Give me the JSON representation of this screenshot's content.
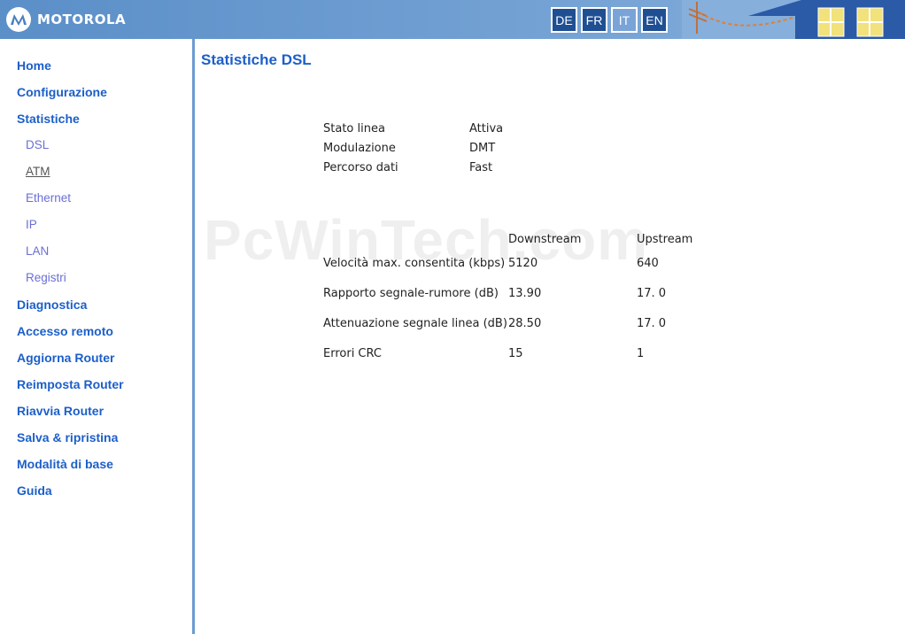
{
  "header": {
    "brand": "MOTOROLA",
    "languages": [
      "DE",
      "FR",
      "IT",
      "EN"
    ],
    "active_language": "IT"
  },
  "sidebar": {
    "items": [
      {
        "label": "Home"
      },
      {
        "label": "Configurazione"
      },
      {
        "label": "Statistiche"
      },
      {
        "label": "DSL"
      },
      {
        "label": "ATM"
      },
      {
        "label": "Ethernet"
      },
      {
        "label": "IP"
      },
      {
        "label": "LAN"
      },
      {
        "label": "Registri"
      },
      {
        "label": "Diagnostica"
      },
      {
        "label": "Accesso remoto"
      },
      {
        "label": "Aggiorna Router"
      },
      {
        "label": "Reimposta Router"
      },
      {
        "label": "Riavvia Router"
      },
      {
        "label": "Salva & ripristina"
      },
      {
        "label": "Modalità di base"
      },
      {
        "label": "Guida"
      }
    ]
  },
  "main": {
    "title": "Statistiche DSL",
    "watermark": "PcWinTech.com",
    "info": [
      {
        "label": "Stato linea",
        "value": "Attiva"
      },
      {
        "label": "Modulazione",
        "value": "DMT"
      },
      {
        "label": "Percorso dati",
        "value": "Fast"
      }
    ],
    "stats": {
      "headers": [
        "Downstream",
        "Upstream"
      ],
      "rows": [
        {
          "label": "Velocità max. consentita (kbps)",
          "down": "5120",
          "up": "640"
        },
        {
          "label": "Rapporto segnale-rumore (dB)",
          "down": "13.90",
          "up": "17. 0"
        },
        {
          "label": "Attenuazione segnale linea (dB)",
          "down": "28.50",
          "up": "17. 0"
        },
        {
          "label": "Errori CRC",
          "down": "15",
          "up": "1"
        }
      ]
    }
  },
  "colors": {
    "header_blue": "#6b9bd0",
    "nav_blue": "#1c5fc9",
    "sub_nav": "#6a6fd6",
    "lang_button": "#1f4f93"
  }
}
